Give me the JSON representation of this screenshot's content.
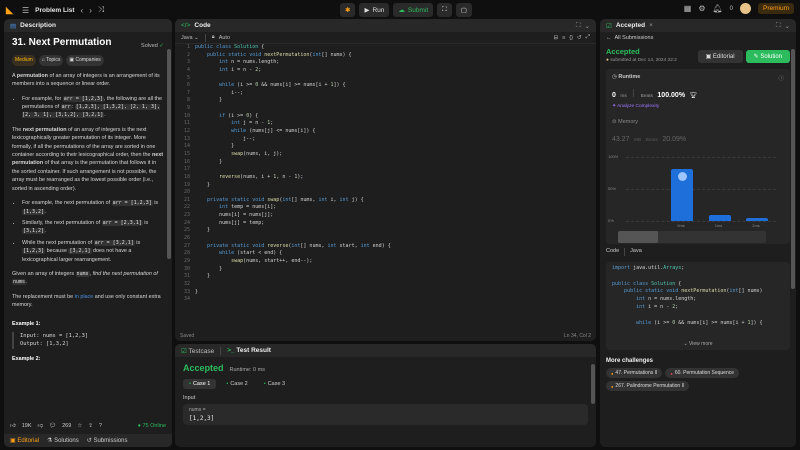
{
  "topbar": {
    "problem_list": "Problem List",
    "run_label": "Run",
    "submit_label": "Submit",
    "notif_count": "0",
    "premium_label": "Premium"
  },
  "description": {
    "tab_label": "Description",
    "title": "31. Next Permutation",
    "solved_label": "Solved",
    "tags": [
      "Medium",
      "Topics",
      "Companies"
    ],
    "p1_bold": "permutation",
    "p1_pre": "A ",
    "p1_post": " of an array of integers is an arrangement of its members into a sequence or linear order.",
    "li1_pre": "For example, for ",
    "li1_code": "arr = [1,2,3]",
    "li1_mid": ", the following are all the permutations of ",
    "li1_code2": "arr",
    "li1_code3": "[1,2,3], [1,3,2], [2, 1, 3], [2, 3, 1], [3,1,2], [3,2,1]",
    "p2_pre": "The ",
    "p2_bold": "next permutation",
    "p2_mid": " of an array of integers is the next lexicographically greater permutation of its integer. More formally, if all the permutations of the array are sorted in one container according to their lexicographical order, then the ",
    "p2_bold2": "next permutation",
    "p2_post": " of that array is the permutation that follows it in the sorted container. If such arrangement is not possible, the array must be rearranged as the lowest possible order (i.e., sorted in ascending order).",
    "li2_pre": "For example, the next permutation of ",
    "li2_code": "arr = [1,2,3]",
    "li2_mid": " is ",
    "li2_code2": "[1,3,2]",
    "li3_pre": "Similarly, the next permutation of ",
    "li3_code": "arr = [2,3,1]",
    "li3_mid": " is ",
    "li3_code2": "[3,1,2]",
    "li4_pre": "While the next permutation of ",
    "li4_code": "arr = [3,2,1]",
    "li4_mid": " is ",
    "li4_code2": "[1,2,3]",
    "li4_mid2": " because ",
    "li4_code3": "[3,2,1]",
    "li4_post": " does not have a lexicographical larger rearrangement.",
    "p3_pre": "Given an array of integers ",
    "p3_code": "nums",
    "p3_em": "find the next permutation of",
    "p3_code2": "nums",
    "p4_pre": "The replacement must be ",
    "p4_link": "in place",
    "p4_post": " and use only constant extra memory.",
    "ex1_title": "Example 1:",
    "ex1_input": "Input: nums = [1,2,3]",
    "ex1_output": "Output: [1,3,2]",
    "ex2_title": "Example 2:",
    "likes": "19K",
    "comments": "269",
    "online": "75 Online",
    "bottom_tabs": [
      "Editorial",
      "Solutions",
      "Submissions"
    ]
  },
  "code": {
    "tab_label": "Code",
    "language": "Java",
    "auto_label": "Auto",
    "saved_label": "Saved",
    "cursor_pos": "Ln 34, Col 2",
    "lines": [
      "public class Solution {",
      "    public static void nextPermutation(int[] nums) {",
      "        int n = nums.length;",
      "        int i = n - 2;",
      "",
      "        while (i >= 0 && nums[i] >= nums[i + 1]) {",
      "            i--;",
      "        }",
      "",
      "        if (i >= 0) {",
      "            int j = n - 1;",
      "            while (nums[j] <= nums[i]) {",
      "                j--;",
      "            }",
      "            swap(nums, i, j);",
      "        }",
      "",
      "        reverse(nums, i + 1, n - 1);",
      "    }",
      "",
      "    private static void swap(int[] nums, int i, int j) {",
      "        int temp = nums[i];",
      "        nums[i] = nums[j];",
      "        nums[j] = temp;",
      "    }",
      "",
      "    private static void reverse(int[] nums, int start, int end) {",
      "        while (start < end) {",
      "            swap(nums, start++, end--);",
      "        }",
      "    }",
      "",
      "}",
      ""
    ]
  },
  "result": {
    "testcase_tab": "Testcase",
    "result_tab": "Test Result",
    "status": "Accepted",
    "runtime": "Runtime: 0 ms",
    "cases": [
      "Case 1",
      "Case 2",
      "Case 3"
    ],
    "input_label": "Input",
    "input_name": "nums =",
    "input_value": "[1,2,3]"
  },
  "submission": {
    "tab_label": "Accepted",
    "all_submissions": "All Submissions",
    "status": "Accepted",
    "submitted_at": "submitted at Dec 14, 2024 22:2",
    "editorial_label": "Editorial",
    "solution_label": "Solution",
    "runtime_label": "Runtime",
    "runtime_value": "0",
    "runtime_unit": "ms",
    "beats_label": "Beats",
    "runtime_beats": "100.00%",
    "analyze_label": "Analyze Complexity",
    "memory_label": "Memory",
    "memory_value": "43.27",
    "memory_unit": "MB",
    "memory_beats": "20.09%",
    "code_label": "Code",
    "code_lang": "Java",
    "code_lines": [
      "import java.util.Arrays;",
      "",
      "public class Solution {",
      "    public static void nextPermutation(int[] nums)",
      "        int n = nums.length;",
      "        int i = n - 2;",
      "",
      "        while (i >= 0 && nums[i] >= nums[i + 1]) {"
    ],
    "view_more": "View more",
    "more_challenges": "More challenges",
    "challenges": [
      {
        "label": "47. Permutations II",
        "color": "#ffa116"
      },
      {
        "label": "60. Permutation Sequence",
        "color": "#ef4743"
      },
      {
        "label": "267. Palindrome Permutation II",
        "color": "#ffa116"
      }
    ]
  },
  "chart_data": {
    "type": "bar",
    "categories": [
      "",
      "0ms",
      "1ms",
      "2ms"
    ],
    "values": [
      0,
      82,
      9,
      4
    ],
    "yticks": [
      "100%",
      "50%",
      "0%"
    ],
    "ylim": [
      0,
      100
    ]
  }
}
